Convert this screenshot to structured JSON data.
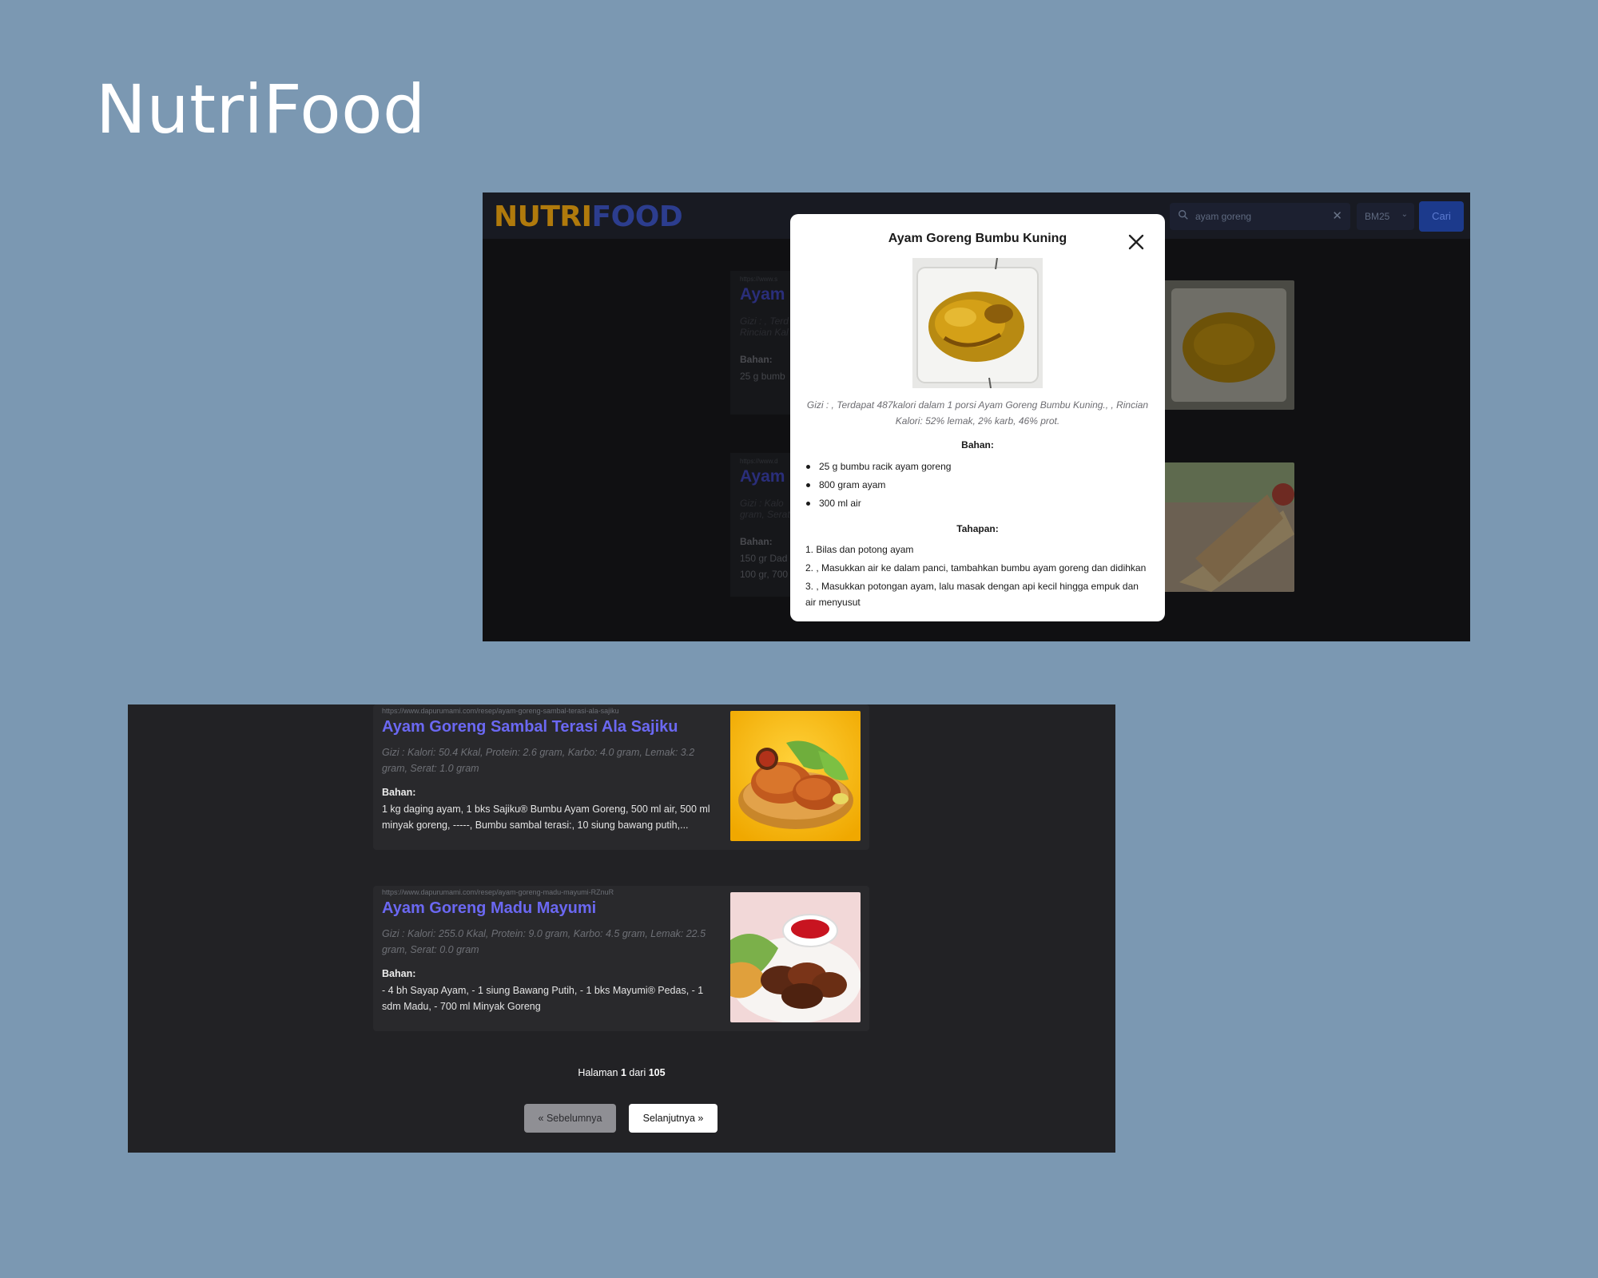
{
  "page": {
    "title": "NutriFood"
  },
  "app": {
    "logo_part1": "NUTRI",
    "logo_part2": "FOOD",
    "search": {
      "value": "ayam goreng",
      "clear_glyph": "✕"
    },
    "algorithm": "BM25",
    "search_button": "Cari",
    "colors": {
      "logo_primary": "#e8a21a",
      "logo_secondary": "#3b52c4",
      "accent": "#6b68f2",
      "button": "#2451c7"
    }
  },
  "background_cards": [
    {
      "url": "https://www.s",
      "title": "Ayam G",
      "gizi": "Gizi : , Terd",
      "gizi2": "Rincian Kal",
      "bahan_label": "Bahan:",
      "ingredients": "25 g bumb"
    },
    {
      "url": "https://www.d",
      "title": "Ayam G",
      "gizi": "Gizi : Kalo",
      "gizi2": "gram, Serat",
      "bahan_label": "Bahan:",
      "ingredients": "150 gr Dad",
      "ingredients2": "100 gr, 700"
    }
  ],
  "modal": {
    "title": "Ayam Goreng Bumbu Kuning",
    "close_icon": "close-icon",
    "gizi": "Gizi : , Terdapat 487kalori dalam 1 porsi Ayam Goreng Bumbu Kuning., , Rincian Kalori: 52% lemak, 2% karb, 46% prot.",
    "bahan_label": "Bahan:",
    "ingredients": [
      "25 g bumbu racik ayam goreng",
      "800 gram ayam",
      "300 ml air"
    ],
    "tahapan_label": "Tahapan:",
    "steps": [
      "1. Bilas dan potong ayam",
      "2. , Masukkan air ke dalam panci, tambahkan bumbu ayam goreng dan didihkan",
      "3. , Masukkan potongan ayam, lalu masak dengan api kecil hingga empuk dan air menyusut"
    ]
  },
  "results": [
    {
      "url": "https://www.dapurumami.com/resep/ayam-goreng-sambal-terasi-ala-sajiku",
      "title": "Ayam Goreng Sambal Terasi Ala Sajiku",
      "gizi": "Gizi : Kalori: 50.4 Kkal, Protein: 2.6 gram, Karbo: 4.0 gram, Lemak: 3.2 gram, Serat: 1.0 gram",
      "bahan_label": "Bahan:",
      "ingredients": "1 kg daging ayam, 1 bks Sajiku® Bumbu Ayam Goreng, 500 ml air, 500 ml minyak goreng, -----, Bumbu sambal terasi:, 10 siung bawang putih,..."
    },
    {
      "url": "https://www.dapurumami.com/resep/ayam-goreng-madu-mayumi-RZnuR",
      "title": "Ayam Goreng Madu Mayumi",
      "gizi": "Gizi : Kalori: 255.0 Kkal, Protein: 9.0 gram, Karbo: 4.5 gram, Lemak: 22.5 gram, Serat: 0.0 gram",
      "bahan_label": "Bahan:",
      "ingredients": "- 4 bh Sayap Ayam, - 1 siung Bawang Putih, - 1 bks Mayumi® Pedas, - 1 sdm Madu, - 700 ml Minyak Goreng"
    }
  ],
  "pagination": {
    "prefix": "Halaman",
    "current": "1",
    "middle": "dari",
    "total": "105",
    "prev_label": "« Sebelumnya",
    "next_label": "Selanjutnya »"
  }
}
